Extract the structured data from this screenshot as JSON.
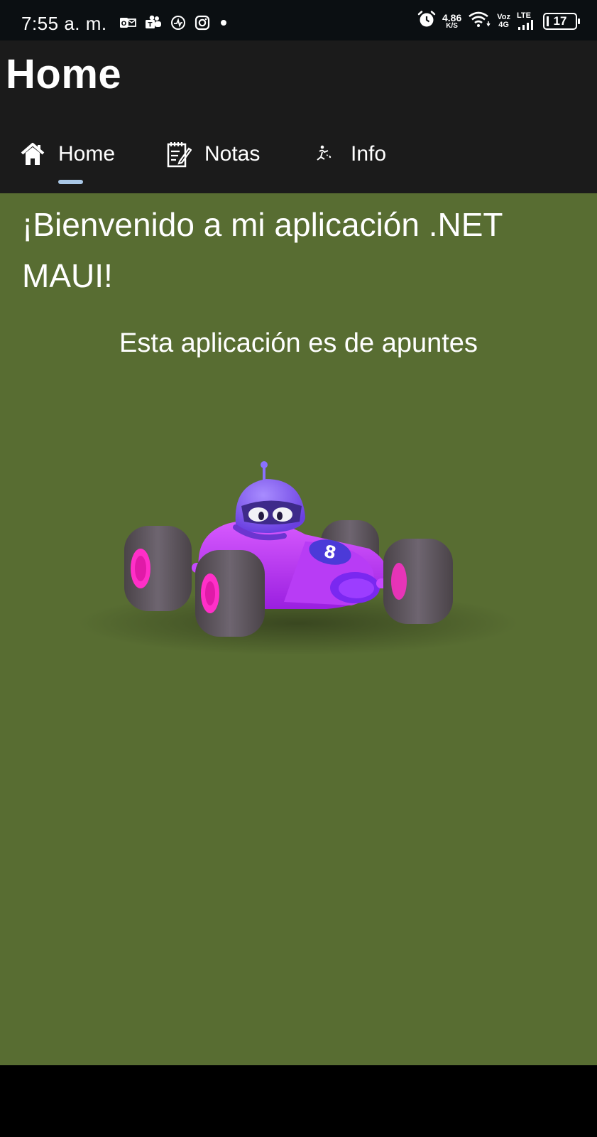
{
  "status_bar": {
    "time": "7:55 a. m.",
    "notification_icons": [
      "outlook-icon",
      "teams-icon",
      "sync-icon",
      "instagram-icon",
      "dot-icon"
    ],
    "speed_value": "4.86",
    "speed_unit": "K/S",
    "network_top": "Voz",
    "network_bottom": "4G",
    "lte": "LTE",
    "battery": "17"
  },
  "app_bar": {
    "title": "Home",
    "tabs": [
      {
        "label": "Home",
        "icon": "home-icon",
        "selected": true
      },
      {
        "label": "Notas",
        "icon": "notes-icon",
        "selected": false
      },
      {
        "label": "Info",
        "icon": "info-icon",
        "selected": false
      }
    ],
    "indicator_color": "#a9c7e6"
  },
  "content": {
    "background": "#586d32",
    "welcome": "¡Bienvenido a mi aplicación .NET MAUI!",
    "subtitle": "Esta aplicación es de apuntes",
    "image": "dotnet-bot-race-car"
  }
}
